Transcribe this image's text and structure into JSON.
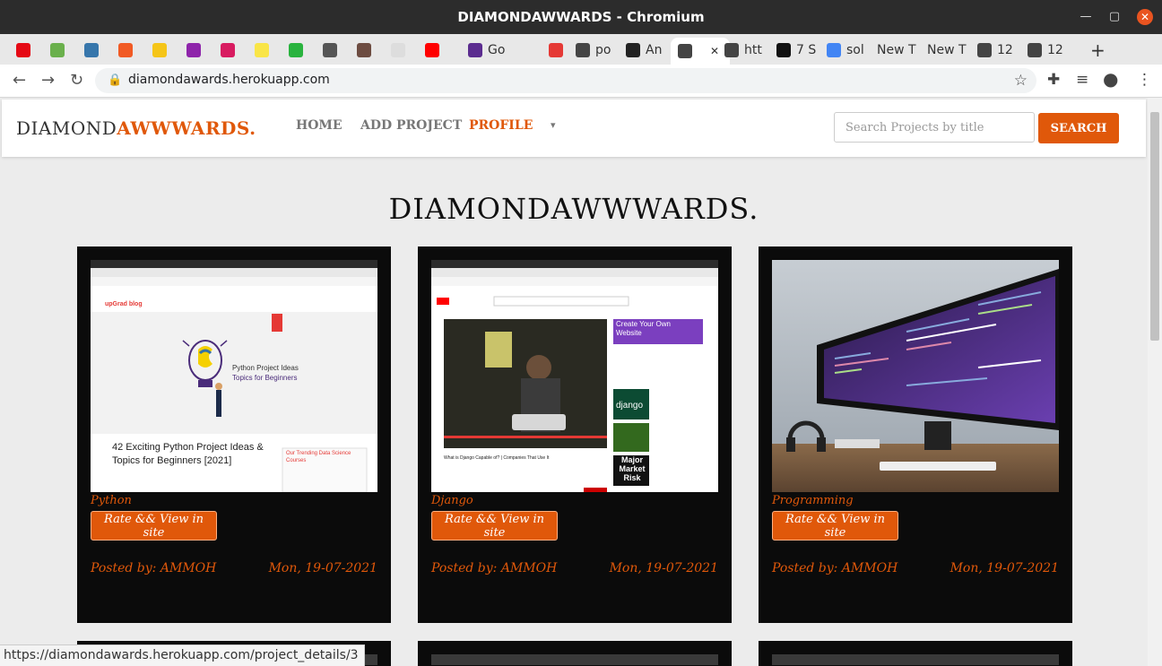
{
  "window": {
    "title": "DIAMONDAWWARDS - Chromium"
  },
  "tabs": [
    {
      "label": "",
      "color": "#e50914"
    },
    {
      "label": "",
      "color": "#6ab04c"
    },
    {
      "label": "",
      "color": "#3776ab"
    },
    {
      "label": "",
      "color": "#f15a24"
    },
    {
      "label": "",
      "color": "#f5c518"
    },
    {
      "label": "",
      "color": "#8e24aa"
    },
    {
      "label": "",
      "color": "#d81b60"
    },
    {
      "label": "",
      "color": "#f9e547"
    },
    {
      "label": "",
      "color": "#29b33e"
    },
    {
      "label": "",
      "color": "#555555"
    },
    {
      "label": "",
      "color": "#6d4c41"
    },
    {
      "label": "",
      "color": "#dddddd"
    },
    {
      "label": "",
      "color": "#ff0000"
    },
    {
      "label": "Go",
      "color": "#5b2c8f"
    },
    {
      "label": "",
      "color": "#e53935"
    },
    {
      "label": "po",
      "color": "#444444"
    },
    {
      "label": "An",
      "color": "#222222"
    },
    {
      "label": "",
      "color": "#444444"
    },
    {
      "label": "htt",
      "color": "#444444"
    },
    {
      "label": "7 S",
      "color": "#111111"
    },
    {
      "label": "sol",
      "color": "#4285f4"
    },
    {
      "label": "New T",
      "color": ""
    },
    {
      "label": "New T",
      "color": ""
    },
    {
      "label": "12",
      "color": "#444444"
    },
    {
      "label": "12",
      "color": "#444444"
    }
  ],
  "address_bar": {
    "url": "diamondawards.herokuapp.com"
  },
  "site": {
    "brand_main": "DIAMOND",
    "brand_accent": "AWWWARDS.",
    "nav": {
      "home": "HOME",
      "add_project": "ADD PROJECT",
      "profile": "PROFILE",
      "dropdown_caret": "▾"
    },
    "search": {
      "placeholder": "Search Projects by title",
      "button": "SEARCH"
    },
    "hero_title": "DIAMONDAWWWARDS.",
    "accent_color": "#e0580a"
  },
  "projects": [
    {
      "category": "Python",
      "rate_label": "Rate && View in site",
      "posted_by": "Posted by: AMMOH",
      "date": "Mon, 19-07-2021",
      "thumb": {
        "headline": "42 Exciting Python Project Ideas & Topics for Beginners [2021]",
        "subtitle": "Python Project Ideas Topics for Beginners",
        "sidebar": "Our Trending Data Science Courses",
        "logo": "upGrad blog"
      }
    },
    {
      "category": "Django",
      "rate_label": "Rate && View in site",
      "posted_by": "Posted by: AMMOH",
      "date": "Mon, 19-07-2021",
      "thumb": {
        "headline": "What is Django Capable of? | Companies That Use It",
        "ad": "Create Your Own Website",
        "video1": "django",
        "video2": "Major Market Risk"
      }
    },
    {
      "category": "Programming",
      "rate_label": "Rate && View in site",
      "posted_by": "Posted by: AMMOH",
      "date": "Mon, 19-07-2021",
      "thumb": {}
    }
  ],
  "status_bar": {
    "text": "https://diamondawards.herokuapp.com/project_details/3"
  }
}
